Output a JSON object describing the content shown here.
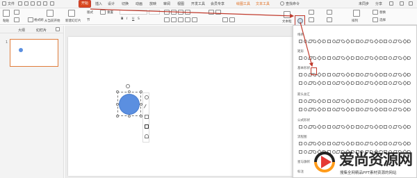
{
  "menubar": {
    "file_label": "文件",
    "tabs": [
      {
        "label": "开始",
        "active": true
      },
      {
        "label": "插入"
      },
      {
        "label": "设计"
      },
      {
        "label": "切换"
      },
      {
        "label": "动画"
      },
      {
        "label": "放映"
      },
      {
        "label": "审阅"
      },
      {
        "label": "视图"
      },
      {
        "label": "开发工具"
      },
      {
        "label": "会员专享"
      },
      {
        "label": "绘图工具"
      },
      {
        "label": "文本工具"
      }
    ],
    "search_label": "查找命令",
    "right_items": [
      "未同步",
      "分享"
    ]
  },
  "ribbon": {
    "paste_label": "粘贴",
    "format_painter_label": "格式刷",
    "from_current_label": "从当前开始",
    "new_slide_label": "新建幻灯片",
    "layout_label": "版式",
    "section_label": "节",
    "reset_label": "重置",
    "text_box_label": "文本框",
    "shape_label": "形状",
    "arrange_label": "排列",
    "replace_label": "替换",
    "select_label": "选择"
  },
  "sidebar": {
    "tabs": [
      "大纲",
      "幻灯片"
    ],
    "slide_number": "1"
  },
  "panel": {
    "sections": [
      "线条",
      "矩形",
      "基本形状",
      "箭头总汇",
      "公式形状",
      "流程图",
      "星与旗帜",
      "标注"
    ]
  },
  "watermark": {
    "title": "爱尚资源网",
    "subtitle": "搜集全网精品PPT素材资源的网站"
  },
  "colors": {
    "accent": "#d9481f",
    "shape_fill": "#5b8fe0",
    "arrow": "#c0392b"
  }
}
